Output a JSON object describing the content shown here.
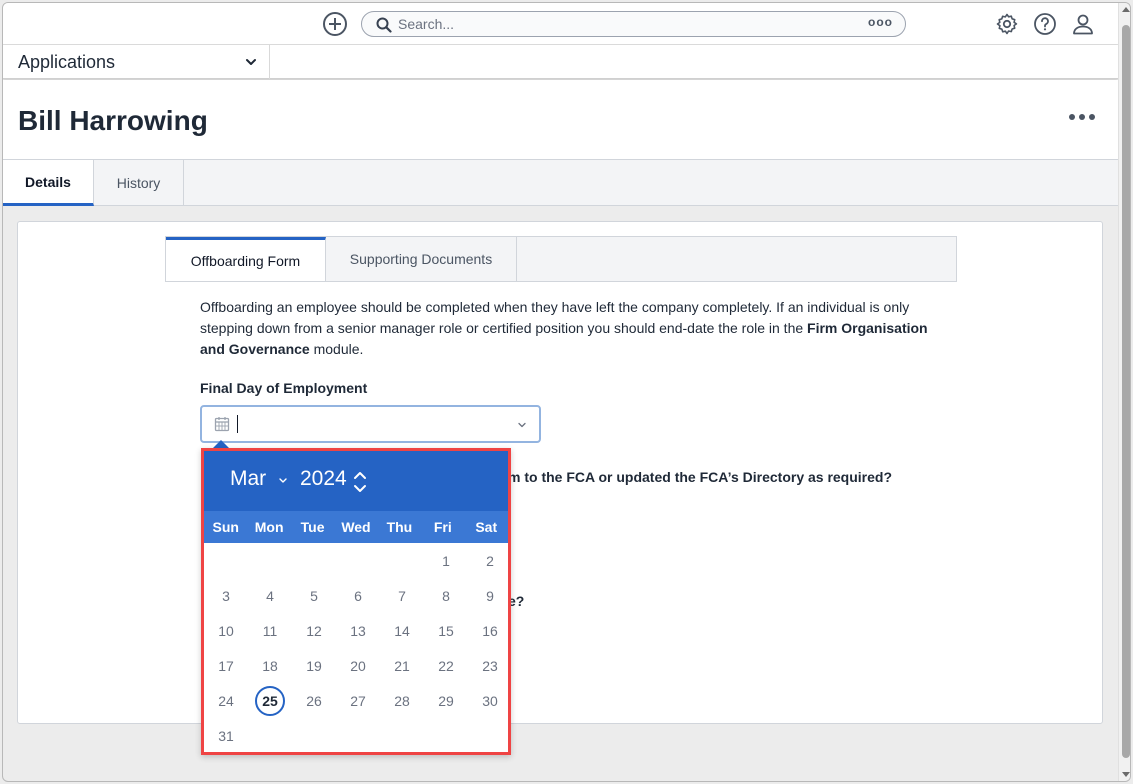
{
  "topbar": {
    "search_placeholder": "Search...",
    "search_more": "ooo",
    "icons": [
      "plus-circle-icon",
      "search-icon",
      "gear-icon",
      "help-icon",
      "user-icon"
    ]
  },
  "appbar": {
    "selected": "Applications"
  },
  "header": {
    "title": "Bill Harrowing"
  },
  "tabs": [
    {
      "label": "Details",
      "active": true
    },
    {
      "label": "History",
      "active": false
    }
  ],
  "form_tabs": [
    {
      "label": "Offboarding Form",
      "active": true
    },
    {
      "label": "Supporting Documents",
      "active": false
    }
  ],
  "form": {
    "desc_part1": "Offboarding an employee should be completed when they have left the company completely. If an individual is only stepping down from a senior manager role or certified position you should end-date the role in the ",
    "desc_bold": "Firm Organisation and Governance",
    "desc_part2": " module.",
    "final_day_label": "Final Day of Employment",
    "final_day_value": "",
    "question1_visible": "m to the FCA or updated the FCA’s Directory as required?",
    "question2_visible": "e?"
  },
  "datepicker": {
    "month": "Mar",
    "year": "2024",
    "weekdays": [
      "Sun",
      "Mon",
      "Tue",
      "Wed",
      "Thu",
      "Fri",
      "Sat"
    ],
    "days": [
      "1",
      "2",
      "3",
      "4",
      "5",
      "6",
      "7",
      "8",
      "9",
      "10",
      "11",
      "12",
      "13",
      "14",
      "15",
      "16",
      "17",
      "18",
      "19",
      "20",
      "21",
      "22",
      "23",
      "24",
      "25",
      "26",
      "27",
      "28",
      "29",
      "30",
      "31"
    ],
    "today": "25",
    "colors": {
      "header": "#2563c4",
      "weekdays": "#3b78d4",
      "highlight_border": "#ef4444"
    }
  }
}
